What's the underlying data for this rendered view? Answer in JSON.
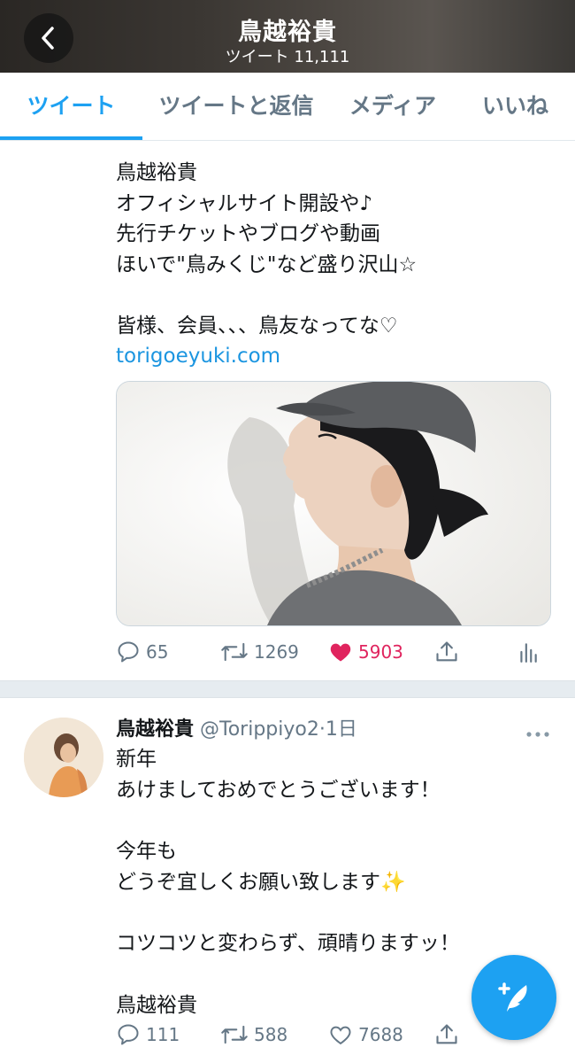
{
  "header": {
    "title": "鳥越裕貴",
    "subtitle": "ツイート 11,111"
  },
  "tabs": [
    {
      "label": "ツイート",
      "active": true
    },
    {
      "label": "ツイートと返信",
      "active": false
    },
    {
      "label": "メディア",
      "active": false
    },
    {
      "label": "いいね",
      "active": false
    }
  ],
  "tweet1": {
    "lines": [
      "鳥越裕貴",
      "オフィシャルサイト開設や♪",
      "先行チケットやブログや動画",
      "ほいで\"鳥みくじ\"など盛り沢山☆",
      "",
      "皆様、会員、、、鳥友なってな♡"
    ],
    "link": "torigoeyuki.com",
    "replies": "65",
    "retweets": "1269",
    "likes": "5903",
    "liked": true
  },
  "tweet2": {
    "name": "鳥越裕貴",
    "handle": "@Torippiyo2",
    "time": "1日",
    "lines": [
      "新年",
      "あけましておめでとうございます！",
      "",
      "今年も",
      "どうぞ宜しくお願い致します✨",
      "",
      "コツコツと変わらず、頑晴りますッ！",
      "",
      "鳥越裕貴"
    ],
    "replies": "111",
    "retweets": "588",
    "likes": "7688"
  },
  "colors": {
    "accent": "#1da1f2",
    "like": "#e0245e",
    "muted": "#657786"
  },
  "icons": [
    "back-arrow-icon",
    "reply-icon",
    "retweet-icon",
    "like-icon",
    "share-icon",
    "analytics-icon",
    "more-icon",
    "compose-icon"
  ]
}
